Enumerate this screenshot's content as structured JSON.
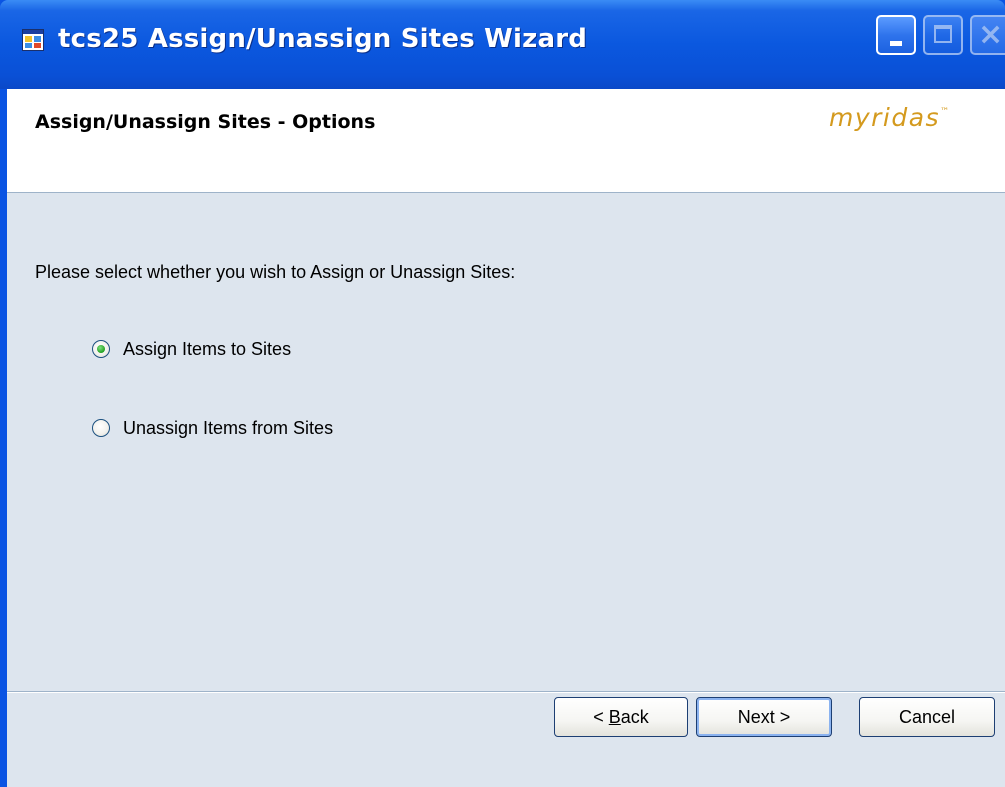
{
  "window": {
    "title": "tcs25 Assign/Unassign Sites Wizard",
    "app_icon": "wizard-app-icon",
    "controls": {
      "minimize_icon": "minimize-icon",
      "maximize_icon": "maximize-icon",
      "close_icon": "close-icon"
    }
  },
  "header": {
    "title": "Assign/Unassign Sites - Options",
    "logo_text": "myridas",
    "logo_mark": "™"
  },
  "content": {
    "prompt": "Please select whether you wish to Assign or Unassign Sites:",
    "options": [
      {
        "label": "Assign Items to Sites",
        "selected": true
      },
      {
        "label": "Unassign Items from Sites",
        "selected": false
      }
    ]
  },
  "footer": {
    "back_prefix": "< ",
    "back_mnemonic": "B",
    "back_rest": "ack",
    "next_label": "Next >",
    "cancel_label": "Cancel"
  },
  "colors": {
    "titlebar": "#0a54e3",
    "panel_background": "#dde5ee",
    "logo": "#d49a1e",
    "selected_radio": "#21a121"
  }
}
